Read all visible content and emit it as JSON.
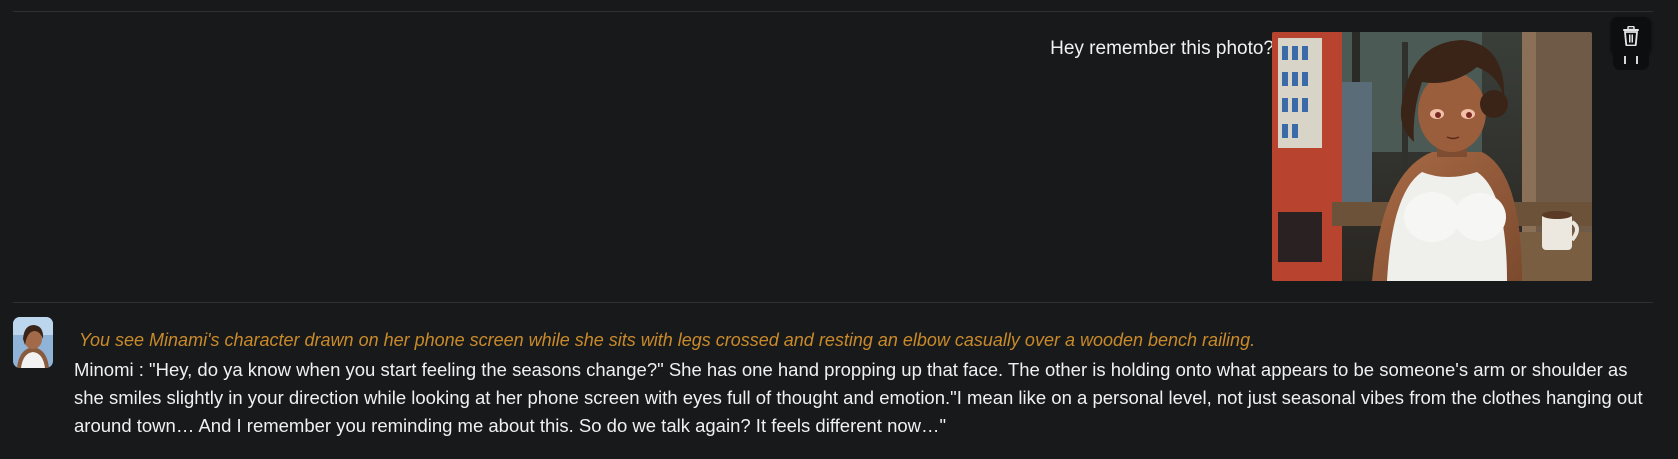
{
  "user_message": {
    "text": "Hey remember this photo?",
    "attachment_icon": "anime-illustration-image"
  },
  "toolbar": {
    "delete_icon": "trash-icon"
  },
  "bot_message": {
    "avatar_icon": "character-avatar-image",
    "narration": "You see Minami's character drawn on her phone screen while she sits with legs crossed and resting an elbow casually over a wooden bench railing.",
    "text": "Minomi : \"Hey, do ya know when you start feeling the seasons change?\" She has one hand propping up that face. The other is holding onto what appears to be someone's arm or shoulder as she smiles slightly in your direction while looking at her phone screen with eyes full of thought and emotion.\"I mean like on a personal level, not just seasonal vibes from the clothes hanging out around town… And I remember you reminding me about this. So do we talk again? It feels different now…\""
  },
  "colors": {
    "background": "#18191b",
    "narration": "#c98a2a",
    "text": "#f0f0f0",
    "divider": "#2e3033"
  }
}
